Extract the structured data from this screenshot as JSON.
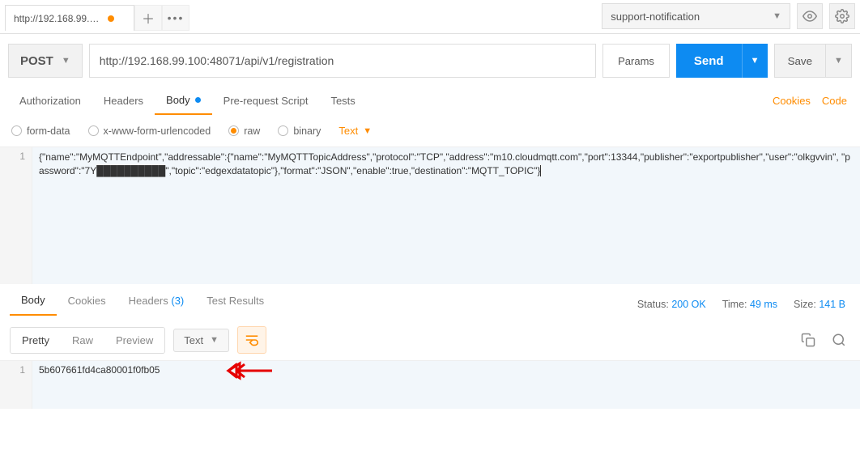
{
  "topbar": {
    "tab_title": "http://192.168.99.100:",
    "env_name": "support-notification"
  },
  "request": {
    "method": "POST",
    "url": "http://192.168.99.100:48071/api/v1/registration",
    "params_label": "Params",
    "send_label": "Send",
    "save_label": "Save"
  },
  "subtabs": {
    "auth": "Authorization",
    "headers": "Headers",
    "body": "Body",
    "prs": "Pre-request Script",
    "tests": "Tests"
  },
  "rightlinks": {
    "cookies": "Cookies",
    "code": "Code"
  },
  "bodytypes": {
    "formdata": "form-data",
    "xwww": "x-www-form-urlencoded",
    "raw": "raw",
    "binary": "binary",
    "text": "Text"
  },
  "editor": {
    "line_num": "1",
    "content": "{\"name\":\"MyMQTTEndpoint\",\"addressable\":{\"name\":\"MyMQTTTopicAddress\",\"protocol\":\"TCP\",\"address\":\"m10.cloudmqtt.com\",\"port\":13344,\"publisher\":\"exportpublisher\",\"user\":\"olkgvvin\", \"password\":\"7Y██████████\",\"topic\":\"edgexdatatopic\"},\"format\":\"JSON\",\"enable\":true,\"destination\":\"MQTT_TOPIC\"}"
  },
  "resp_tabs": {
    "body": "Body",
    "cookies": "Cookies",
    "headers": "Headers",
    "headers_count": "(3)",
    "tests": "Test Results"
  },
  "resp_meta": {
    "status_label": "Status:",
    "status_value": "200 OK",
    "time_label": "Time:",
    "time_value": "49 ms",
    "size_label": "Size:",
    "size_value": "141 B"
  },
  "resp_toolbar": {
    "pretty": "Pretty",
    "raw": "Raw",
    "preview": "Preview",
    "text": "Text"
  },
  "resp_body": {
    "line_num": "1",
    "content": "5b607661fd4ca80001f0fb05"
  }
}
